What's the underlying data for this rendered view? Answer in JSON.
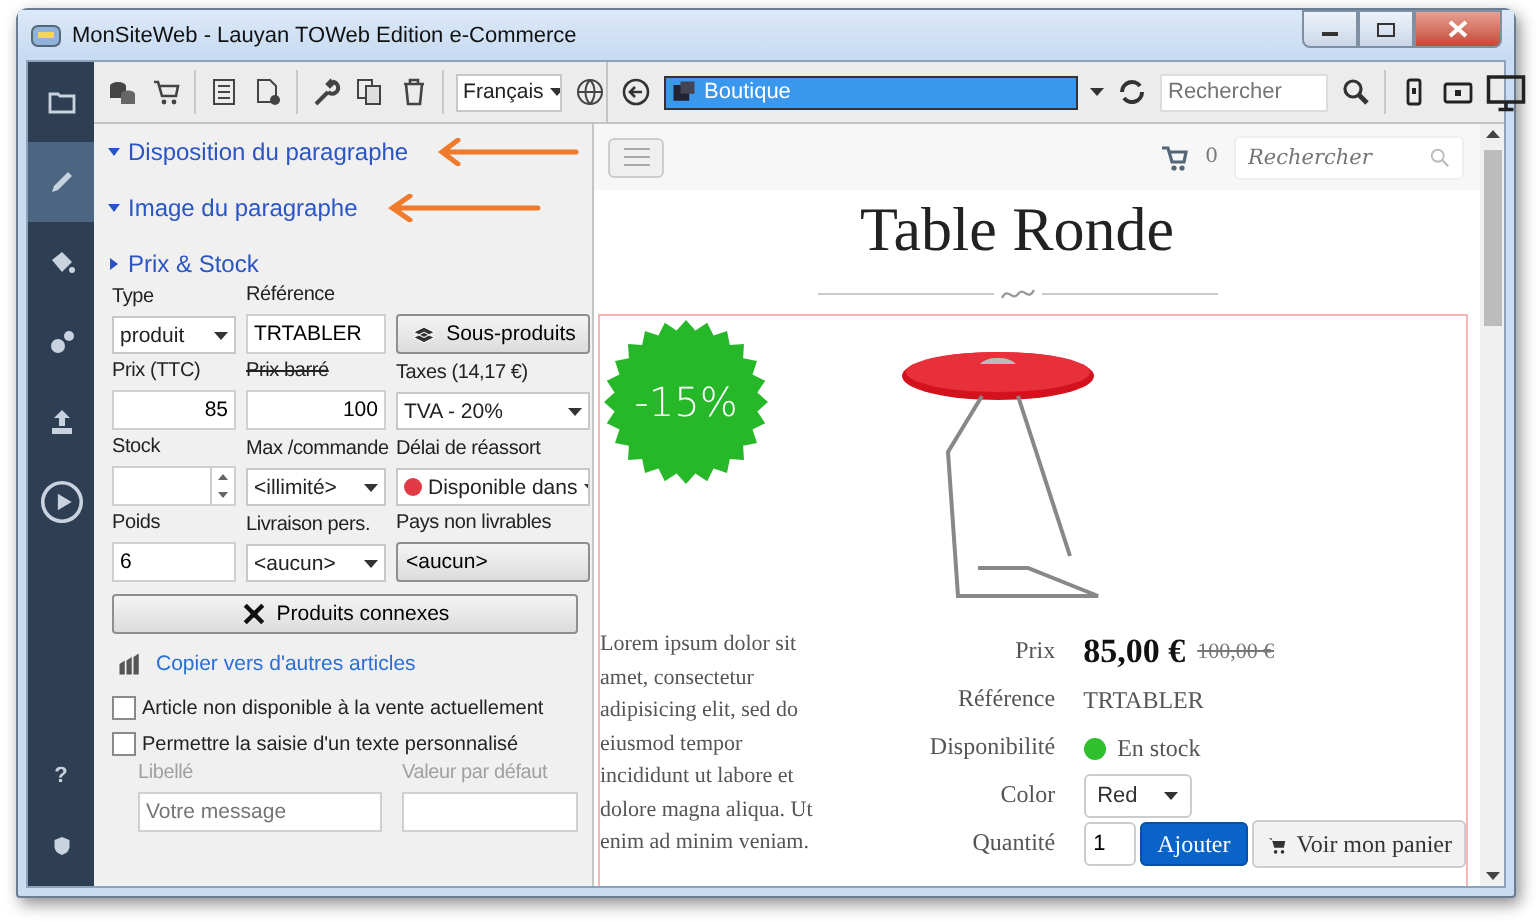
{
  "window": {
    "title": "MonSiteWeb - Lauyan TOWeb Edition e-Commerce"
  },
  "nav": [
    {
      "selected": false
    },
    {
      "selected": true
    },
    {
      "selected": false
    },
    {
      "selected": false
    },
    {
      "selected": false
    },
    {
      "selected": false
    }
  ],
  "nav_bottom": [
    {
      "label": "?"
    }
  ],
  "toolbar": {
    "language": "Français"
  },
  "browser_bar": {
    "address": "Boutique",
    "search_placeholder": "Rechercher"
  },
  "sections": [
    {
      "title": "Disposition du paragraphe",
      "expanded": true,
      "highlighted": true
    },
    {
      "title": "Image du paragraphe",
      "expanded": true,
      "highlighted": true
    },
    {
      "title": "Prix & Stock",
      "expanded": false
    }
  ],
  "fields": [
    {
      "label": "Type",
      "kind": "select",
      "value": "produit"
    },
    {
      "label": "Référence",
      "kind": "text",
      "value": "TRTABLER"
    },
    {
      "kind": "icon-button",
      "value": "Sous-produits"
    },
    {
      "label": "Prix (TTC)",
      "kind": "number",
      "value": "85"
    },
    {
      "label": "Prix barré",
      "kind": "number",
      "value": "100",
      "struck": true
    },
    {
      "label": "Taxes (14,17 €)",
      "kind": "select",
      "value": "TVA - 20%"
    },
    {
      "label": "Stock",
      "kind": "spinner"
    },
    {
      "label": "Max /commande",
      "kind": "select",
      "value": "<illimité>"
    },
    {
      "label": "Délai de réassort",
      "kind": "status-select",
      "value": "Disponible dans",
      "color": "#e03a45"
    },
    {
      "label": "Poids",
      "kind": "text",
      "value": "6"
    },
    {
      "label": "Livraison pers.",
      "kind": "select",
      "value": "<aucun>"
    },
    {
      "label": "Pays non livrables",
      "kind": "button",
      "value": "<aucun>"
    }
  ],
  "related_button": "Produits connexes",
  "copy_link": "Copier vers d'autres articles",
  "checkboxes": [
    {
      "label": "Article non disponible à la vente actuellement",
      "checked": false
    },
    {
      "label": "Permettre la saisie d'un texte personnalisé",
      "checked": false
    }
  ],
  "custom_text": [
    {
      "label": "Libellé",
      "placeholder": "Votre message",
      "disabled": true
    },
    {
      "label": "Valeur par défaut",
      "disabled": true
    }
  ],
  "preview": {
    "cart_count": "0",
    "search_placeholder": "Rechercher",
    "title": "Table Ronde",
    "badge": "-15%",
    "description": "Lorem ipsum dolor sit amet, consectetur adipisicing elit, sed do eiusmod tempor incididunt ut labore et dolore magna aliqua. Ut enim ad minim veniam.",
    "details": [
      {
        "kind": "price",
        "label": "Prix",
        "value": "85,00 €",
        "old_value": "100,00 €"
      },
      {
        "kind": "text",
        "label": "Référence",
        "value": "TRTABLER"
      },
      {
        "kind": "status",
        "label": "Disponibilité",
        "value": "En stock",
        "color": "#2fbf2f"
      },
      {
        "kind": "select",
        "label": "Color",
        "value": "Red"
      },
      {
        "kind": "quantity",
        "label": "Quantité",
        "value": "1",
        "button": "Ajouter",
        "cart_button": "Voir mon panier"
      }
    ]
  }
}
